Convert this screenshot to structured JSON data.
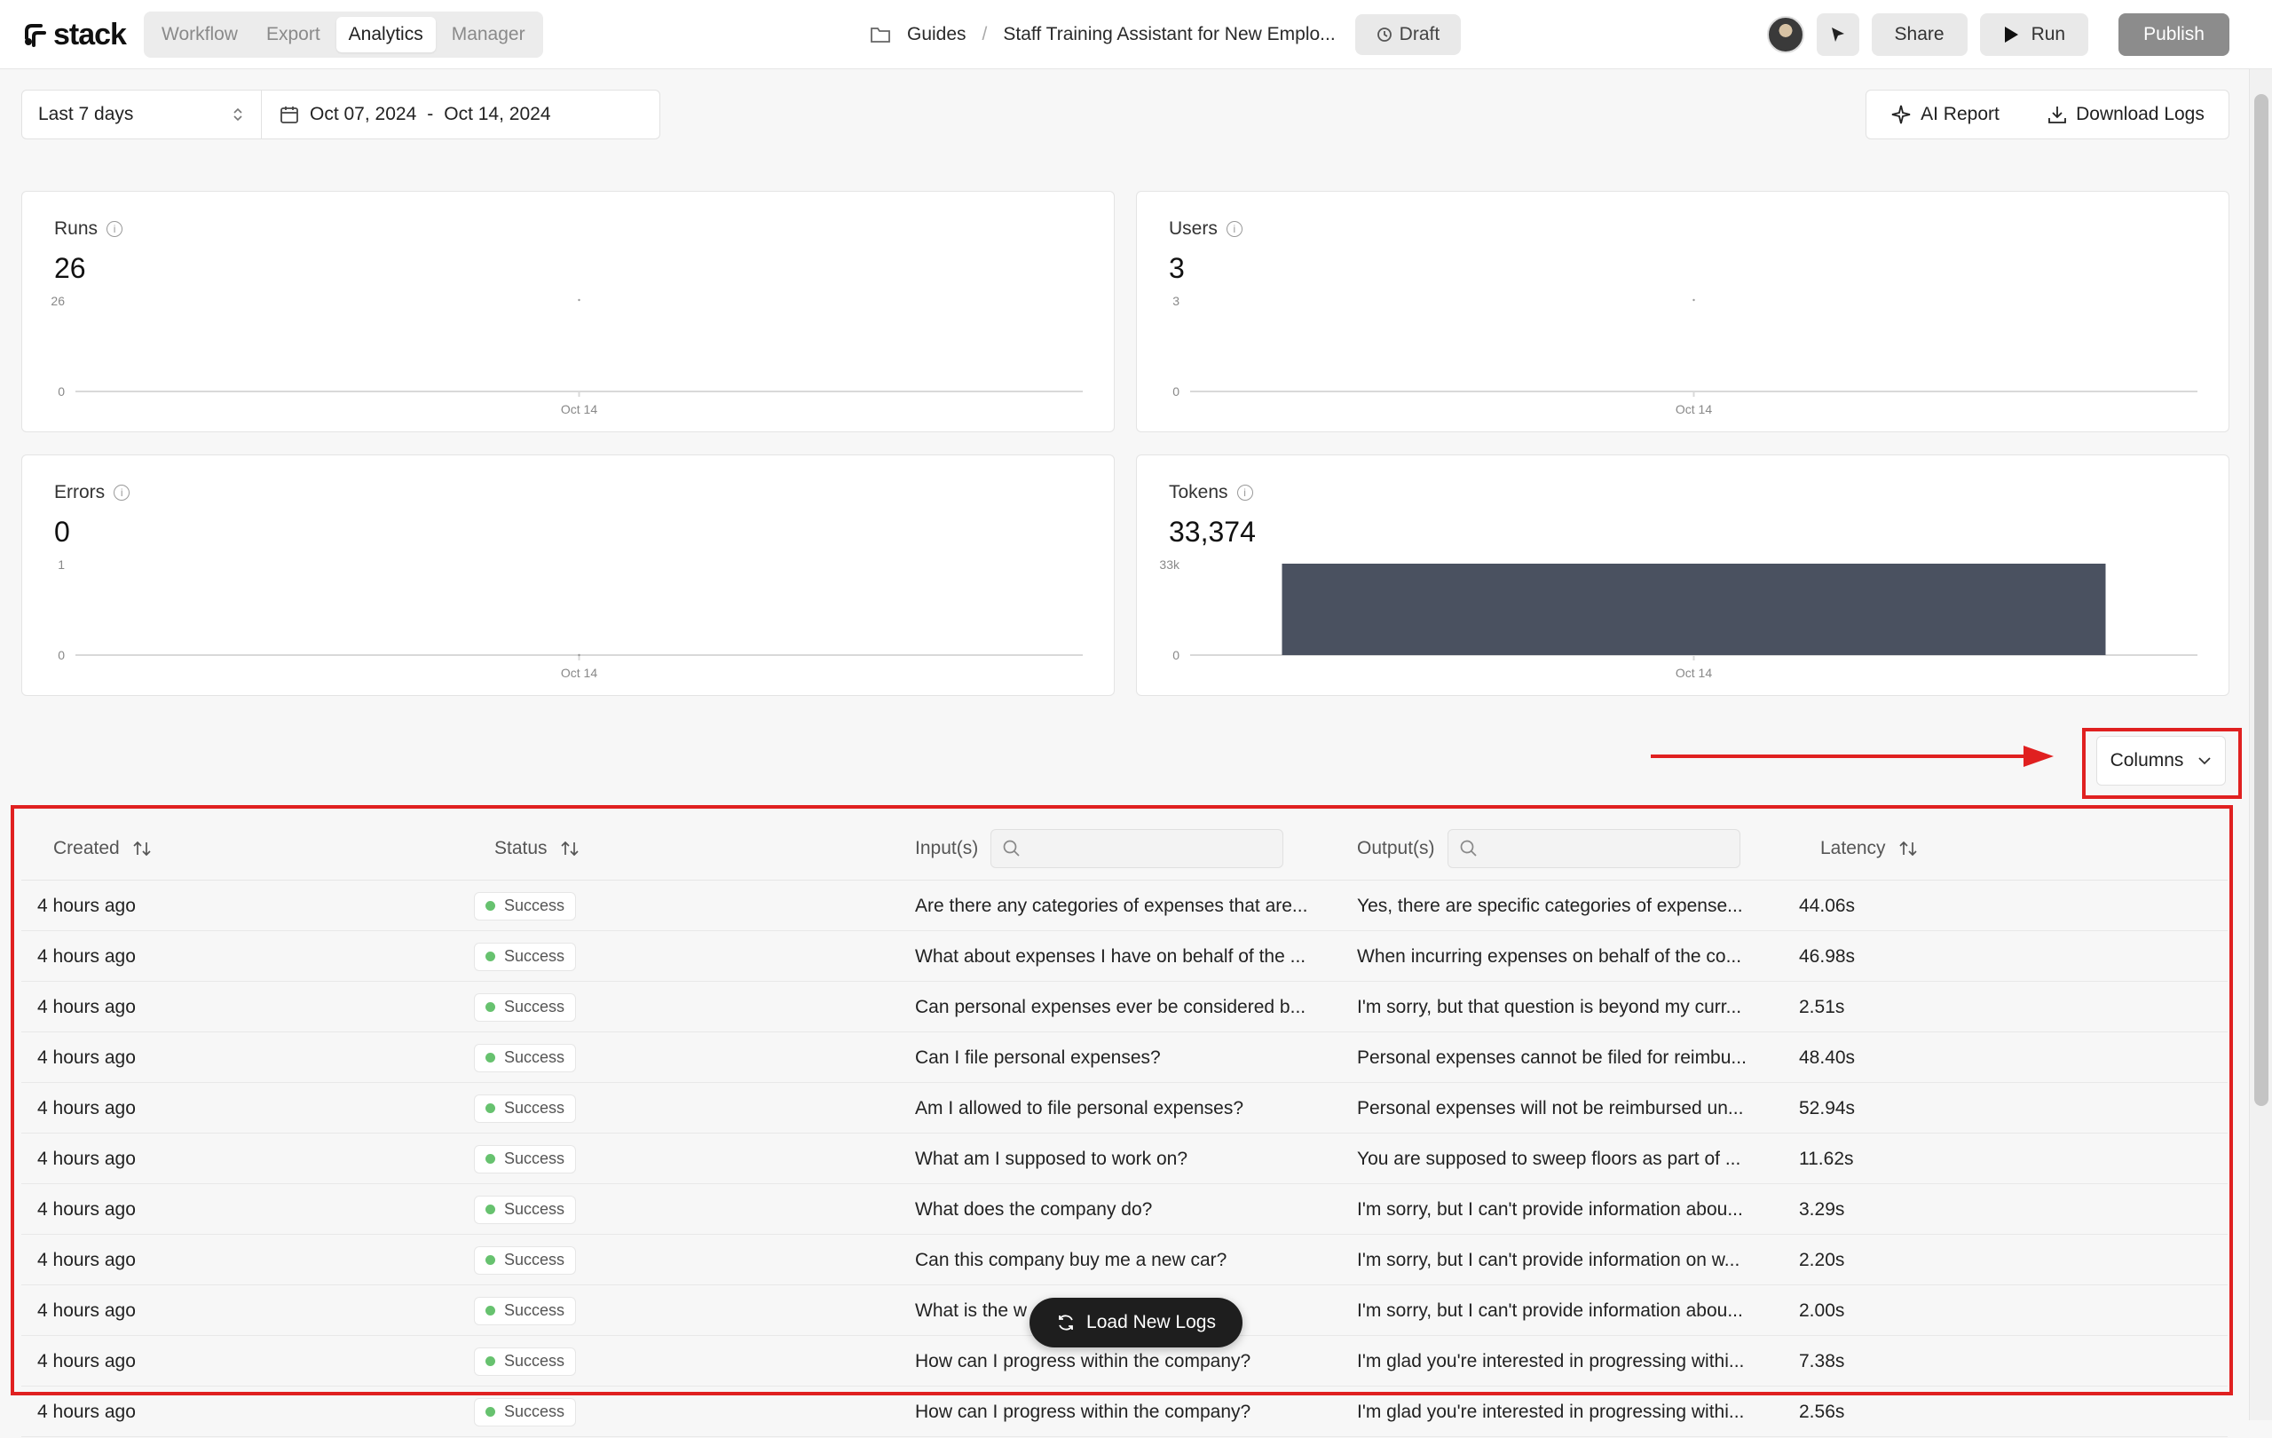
{
  "app": {
    "logo": "stack"
  },
  "nav": {
    "tabs": [
      "Workflow",
      "Export",
      "Analytics",
      "Manager"
    ]
  },
  "breadcrumb": {
    "folder": "Guides",
    "project": "Staff Training Assistant for New Emplo...",
    "draft_label": "Draft"
  },
  "header": {
    "share_label": "Share",
    "run_label": "Run",
    "publish_label": "Publish"
  },
  "filters": {
    "range_label": "Last 7 days",
    "start_date": "Oct 07, 2024",
    "date_sep": "-",
    "end_date": "Oct 14, 2024"
  },
  "actions": {
    "ai_report_label": "AI Report",
    "download_logs_label": "Download Logs"
  },
  "cards": [
    {
      "title": "Runs",
      "value": "26",
      "ymax_label": "26",
      "ymin_label": "0",
      "xtick": "Oct 14"
    },
    {
      "title": "Users",
      "value": "3",
      "ymax_label": "3",
      "ymin_label": "0",
      "xtick": "Oct 14"
    },
    {
      "title": "Errors",
      "value": "0",
      "ymax_label": "1",
      "ymin_label": "0",
      "xtick": "Oct 14"
    },
    {
      "title": "Tokens",
      "value": "33,374",
      "ymax_label": "33k",
      "ymin_label": "0",
      "xtick": "Oct 14"
    }
  ],
  "chart_data": [
    {
      "type": "bar",
      "title": "Runs",
      "categories": [
        "Oct 14"
      ],
      "values": [
        26
      ],
      "ylim": [
        0,
        26
      ]
    },
    {
      "type": "bar",
      "title": "Users",
      "categories": [
        "Oct 14"
      ],
      "values": [
        3
      ],
      "ylim": [
        0,
        3
      ]
    },
    {
      "type": "bar",
      "title": "Errors",
      "categories": [
        "Oct 14"
      ],
      "values": [
        0
      ],
      "ylim": [
        0,
        1
      ]
    },
    {
      "type": "bar",
      "title": "Tokens",
      "categories": [
        "Oct 14"
      ],
      "values": [
        33374
      ],
      "ylim": [
        0,
        33374
      ],
      "bar_color": "#4a5160"
    }
  ],
  "columns_button": {
    "label": "Columns"
  },
  "table": {
    "headers": {
      "created": "Created",
      "status": "Status",
      "inputs": "Input(s)",
      "outputs": "Output(s)",
      "latency": "Latency"
    },
    "rows": [
      {
        "created": "4 hours ago",
        "status": "Success",
        "input": "Are there any categories of expenses that are...",
        "output": "Yes, there are specific categories of expense...",
        "latency": "44.06s"
      },
      {
        "created": "4 hours ago",
        "status": "Success",
        "input": "What about expenses I have on behalf of the ...",
        "output": "When incurring expenses on behalf of the co...",
        "latency": "46.98s"
      },
      {
        "created": "4 hours ago",
        "status": "Success",
        "input": "Can personal expenses ever be considered b...",
        "output": "I'm sorry, but that question is beyond my curr...",
        "latency": "2.51s"
      },
      {
        "created": "4 hours ago",
        "status": "Success",
        "input": "Can I file personal expenses?",
        "output": "Personal expenses cannot be filed for reimbu...",
        "latency": "48.40s"
      },
      {
        "created": "4 hours ago",
        "status": "Success",
        "input": "Am I allowed to file personal expenses?",
        "output": "Personal expenses will not be reimbursed un...",
        "latency": "52.94s"
      },
      {
        "created": "4 hours ago",
        "status": "Success",
        "input": "What am I supposed to work on?",
        "output": "You are supposed to sweep floors as part of ...",
        "latency": "11.62s"
      },
      {
        "created": "4 hours ago",
        "status": "Success",
        "input": "What does the company do?",
        "output": "I'm sorry, but I can't provide information abou...",
        "latency": "3.29s"
      },
      {
        "created": "4 hours ago",
        "status": "Success",
        "input": "Can this company buy me a new car?",
        "output": "I'm sorry, but I can't provide information on w...",
        "latency": "2.20s"
      },
      {
        "created": "4 hours ago",
        "status": "Success",
        "input": "What is the w",
        "output": "I'm sorry, but I can't provide information abou...",
        "latency": "2.00s"
      },
      {
        "created": "4 hours ago",
        "status": "Success",
        "input": "How can I progress within the company?",
        "output": "I'm glad you're interested in progressing withi...",
        "latency": "7.38s"
      },
      {
        "created": "4 hours ago",
        "status": "Success",
        "input": "How can I progress within the company?",
        "output": "I'm glad you're interested in progressing withi...",
        "latency": "2.56s"
      }
    ]
  },
  "load_new_logs": {
    "label": "Load New Logs"
  },
  "colors": {
    "highlight": "#e02020",
    "success_dot": "#67c26f",
    "bar": "#4a5160"
  }
}
